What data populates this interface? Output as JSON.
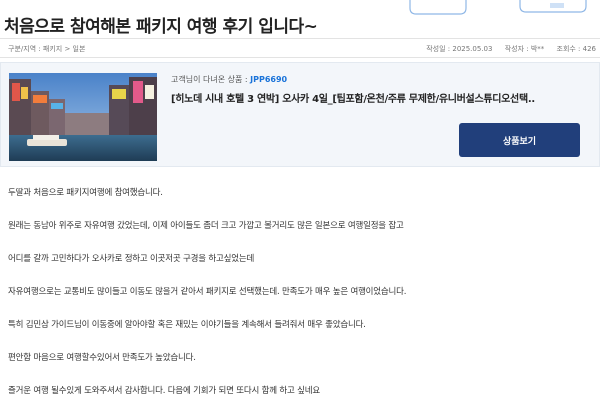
{
  "page": {
    "title": "처음으로 참여해본 패키지 여행 후기 입니다~"
  },
  "meta": {
    "category": "구분/지역 : 패키지 > 일본",
    "date": "작성일 : 2025.05.03",
    "author": "작성자 : 박**",
    "views": "조회수 : 426"
  },
  "product": {
    "visited_label": "고객님이 다녀온 상품 : ",
    "code": "JPP6690",
    "name": "[히노데 시내 호텔 3 연박] 오사카 4일_[팁포함/온천/주류 무제한/유니버설스튜디오선택..",
    "button_label": "상품보기",
    "thumbnail_icon": "osaka-city-canal-photo-icon"
  },
  "review": {
    "lines": [
      "두딸과 처음으로 패키지여행에 참여했습니다.",
      "원래는 동남아 위주로 자유여행 갔었는데, 이제 아이들도 좀더 크고 가깝고 볼거리도 많은 일본으로 여행일정을 잡고",
      "어디를 갈까 고민하다가 오사카로 정하고 이곳저곳 구경을 하고싶었는데",
      "자유여행으로는 교통비도 많이들고 이동도 많을거 같아서 패키지로 선택했는데. 만족도가 매우 높은 여행이었습니다.",
      "특히 김민삼 가이드님이 이동중에 알아야할 혹은 재밌는 이야기들을 계속해서 들려줘서 매우 좋았습니다.",
      "편안함 마음으로 여행할수있어서 만족도가 높았습니다.",
      "즐거운 여행 될수있게 도와주셔서 감사합니다. 다음에 기회가 되면 또다시 함께 하고 싶네요"
    ]
  },
  "colors": {
    "button_bg": "#213f7b",
    "code_text": "#1a73d9",
    "card_bg": "#f3f6fa"
  }
}
